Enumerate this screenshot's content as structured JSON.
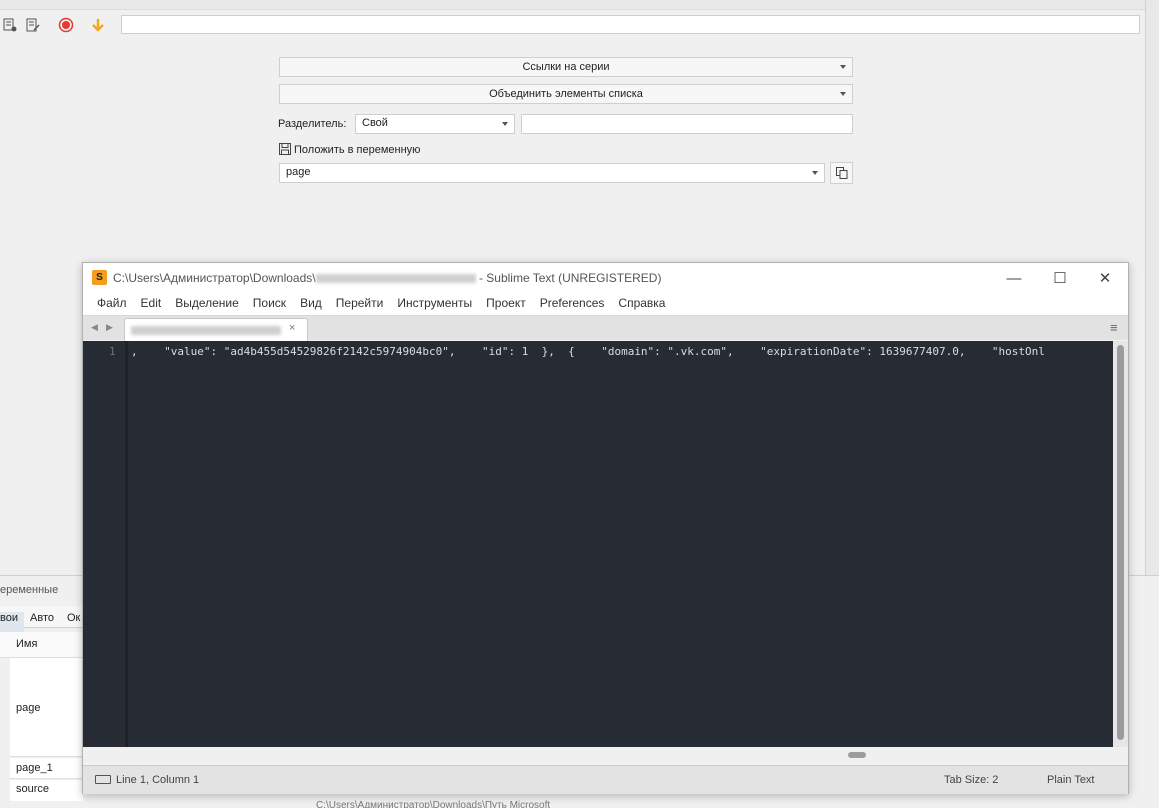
{
  "app": {
    "form": {
      "dropdown1": "Ссылки на серии",
      "dropdown2": "Объединить элементы списка",
      "separator_label": "Разделитель:",
      "separator_value": "Свой",
      "save_to_var_label": "Положить в переменную",
      "var_value": "page"
    },
    "panel": {
      "title": "еременные",
      "tabs": [
        "вои",
        "Авто",
        "Ок"
      ],
      "column_name": "Имя",
      "rows": [
        "page",
        "page_1",
        "source"
      ],
      "path_fragment": "C:\\Users\\Администратор\\Downloads\\Путь Microsoft"
    }
  },
  "sublime": {
    "title_prefix": "C:\\Users\\Администратор\\Downloads\\",
    "title_suffix": " - Sublime Text (UNREGISTERED)",
    "menu": [
      "Файл",
      "Edit",
      "Выделение",
      "Поиск",
      "Вид",
      "Перейти",
      "Инструменты",
      "Проект",
      "Preferences",
      "Справка"
    ],
    "line_number": "1",
    "code_line": ",    \"value\": \"ad4b455d54529826f2142c5974904bc0\",    \"id\": 1  },  {    \"domain\": \".vk.com\",    \"expirationDate\": 1639677407.0,    \"hostOnl",
    "status_left": "Line 1, Column 1",
    "status_tab_size": "Tab Size: 2",
    "status_syntax": "Plain Text"
  },
  "colors": {
    "record": "#e53935",
    "download": "#f5a623",
    "sublime_logo": "#f59c1a",
    "editor_bg": "#272b33"
  }
}
